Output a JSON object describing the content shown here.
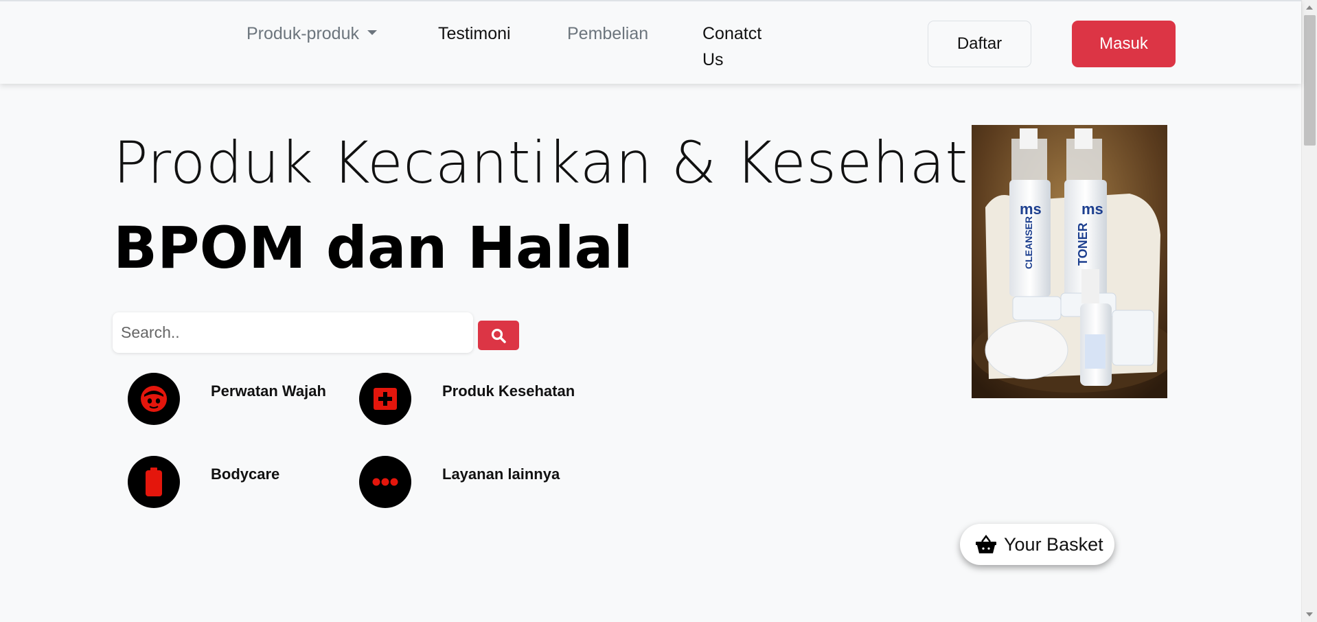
{
  "navbar": {
    "items": [
      {
        "label": "Produk-produk",
        "has_dropdown": true
      },
      {
        "label": "Testimoni"
      },
      {
        "label": "Pembelian"
      },
      {
        "label": "Conatct"
      },
      {
        "label": "Us"
      }
    ],
    "daftar_label": "Daftar",
    "masuk_label": "Masuk"
  },
  "hero": {
    "title": "Produk Kecantikan & Kesehatan",
    "subtitle": "BPOM dan Halal"
  },
  "search": {
    "placeholder": "Search..",
    "button_icon": "search-icon"
  },
  "categories": [
    {
      "label": "Perwatan Wajah",
      "icon": "face-icon"
    },
    {
      "label": "Produk Kesehatan",
      "icon": "medkit-icon"
    },
    {
      "label": "Bodycare",
      "icon": "battery-icon"
    },
    {
      "label": "Layanan lainnya",
      "icon": "more-dots-icon"
    }
  ],
  "basket": {
    "label": "Your Basket",
    "icon": "basket-icon"
  },
  "colors": {
    "accent": "#dc3545",
    "icon_fg": "#e4160c",
    "background": "#f8f9fa"
  }
}
